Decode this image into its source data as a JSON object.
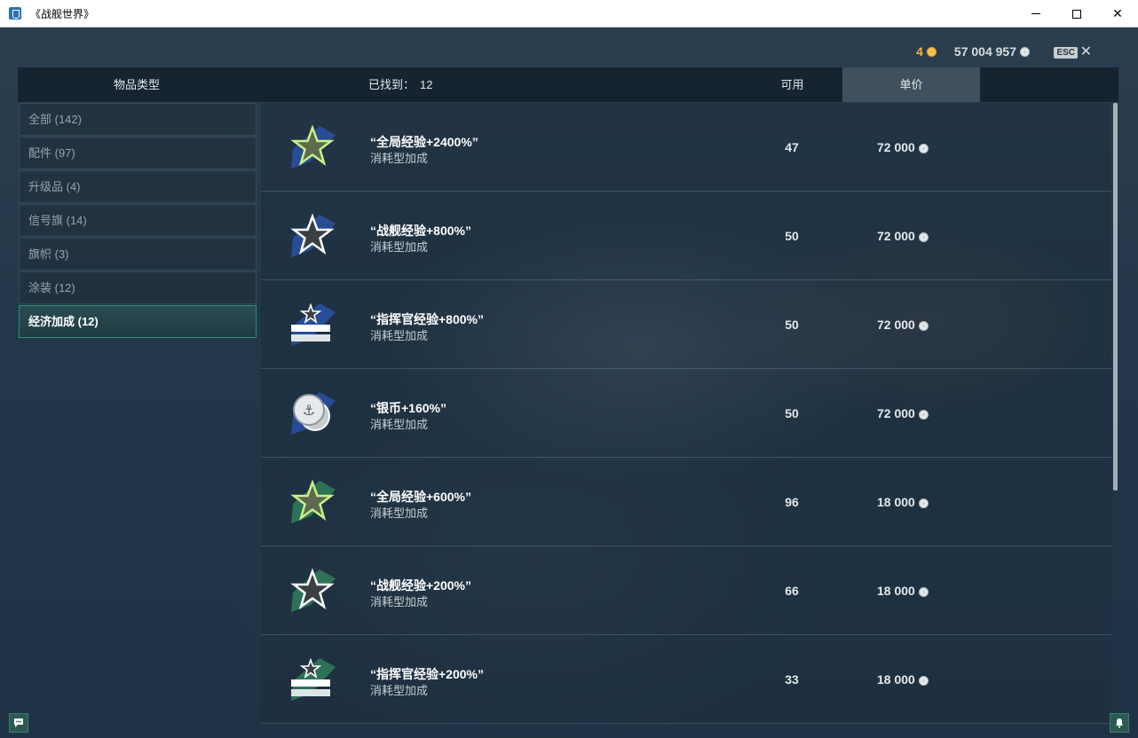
{
  "window": {
    "title": "《战舰世界》"
  },
  "currency": {
    "gold": "4",
    "credits": "57 004 957",
    "esc_label": "ESC",
    "close_glyph": "✕"
  },
  "header": {
    "item_type": "物品类型",
    "found_label": "已找到：",
    "found_count": "12",
    "available": "可用",
    "unit_price": "单价"
  },
  "sidebar": {
    "items": [
      {
        "label": "全部 (142)"
      },
      {
        "label": "配件 (97)"
      },
      {
        "label": "升级品 (4)"
      },
      {
        "label": "信号旗 (14)"
      },
      {
        "label": "旗帜 (3)"
      },
      {
        "label": "涂装 (12)"
      },
      {
        "label": "经济加成 (12)"
      }
    ],
    "active_index": 6
  },
  "items": [
    {
      "name": "“全局经验+2400%”",
      "type": "消耗型加成",
      "available": "47",
      "price": "72 000",
      "icon": "green-star-icon",
      "backdrop": "blue"
    },
    {
      "name": "“战舰经验+800%”",
      "type": "消耗型加成",
      "available": "50",
      "price": "72 000",
      "icon": "outline-star-icon",
      "backdrop": "blue"
    },
    {
      "name": "“指挥官经验+800%”",
      "type": "消耗型加成",
      "available": "50",
      "price": "72 000",
      "icon": "commander-insignia-icon",
      "backdrop": "blue"
    },
    {
      "name": "“银币+160%”",
      "type": "消耗型加成",
      "available": "50",
      "price": "72 000",
      "icon": "silver-coins-icon",
      "backdrop": "blue"
    },
    {
      "name": "“全局经验+600%”",
      "type": "消耗型加成",
      "available": "96",
      "price": "18 000",
      "icon": "green-star-icon",
      "backdrop": "green"
    },
    {
      "name": "“战舰经验+200%”",
      "type": "消耗型加成",
      "available": "66",
      "price": "18 000",
      "icon": "outline-star-icon",
      "backdrop": "green"
    },
    {
      "name": "“指挥官经验+200%”",
      "type": "消耗型加成",
      "available": "33",
      "price": "18 000",
      "icon": "commander-insignia-icon",
      "backdrop": "green"
    }
  ],
  "colors": {
    "gold": "#f3b63a",
    "active_border": "#2f8f79",
    "blue_backdrop": "#2a4fa0",
    "green_backdrop": "#2f7a5a"
  }
}
